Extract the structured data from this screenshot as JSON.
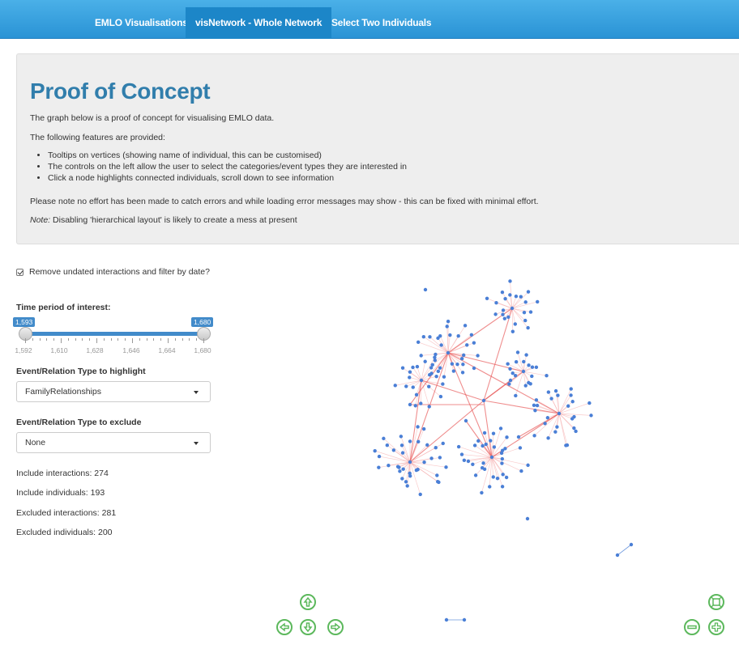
{
  "navbar": {
    "tabs": [
      {
        "label": "EMLO Visualisations"
      },
      {
        "label": "visNetwork - Whole Network"
      },
      {
        "label": "Select Two Individuals"
      }
    ]
  },
  "jumbotron": {
    "title": "Proof of Concept",
    "intro": "The graph below is a proof of concept for visualising EMLO data.",
    "features_heading": "The following features are provided:",
    "features": [
      "Tooltips on vertices (showing name of individual, this can be customised)",
      "The controls on the left allow the user to select the categories/event types they are interested in",
      "Click a node highlights connected individuals, scroll down to see information"
    ],
    "errors_note": "Please note no effort has been made to catch errors and while loading error messages may show - this can be fixed with minimal effort.",
    "note_label": "Note:",
    "note_text": " Disabling 'hierarchical layout' is likely to create a mess at present"
  },
  "sidebar": {
    "undated_checkbox": {
      "label": "Remove undated interactions and filter by date?",
      "checked": true
    },
    "time_period": {
      "label": "Time period of interest:",
      "min": "1,593",
      "max": "1,680",
      "ticks": [
        "1,592",
        "1,610",
        "1,628",
        "1,646",
        "1,664",
        "1,680"
      ]
    },
    "highlight": {
      "label": "Event/Relation Type to highlight",
      "value": "FamilyRelationships"
    },
    "exclude": {
      "label": "Event/Relation Type to exclude",
      "value": "None"
    },
    "stats": [
      "Include interactions: 274",
      "Include individuals: 193",
      "Excluded interactions: 281",
      "Excluded individuals: 200"
    ]
  },
  "network": {
    "node_color": "#4a7fd6",
    "edge_color": "#f4a0a0",
    "highlight_edge_color": "#e85c5c",
    "nav_color": "#5cb85c",
    "nav_buttons": [
      "up-arrow-icon",
      "left-arrow-icon",
      "down-arrow-icon",
      "right-arrow-icon",
      "zoom-extends-icon",
      "zoom-out-icon",
      "zoom-in-icon"
    ]
  }
}
